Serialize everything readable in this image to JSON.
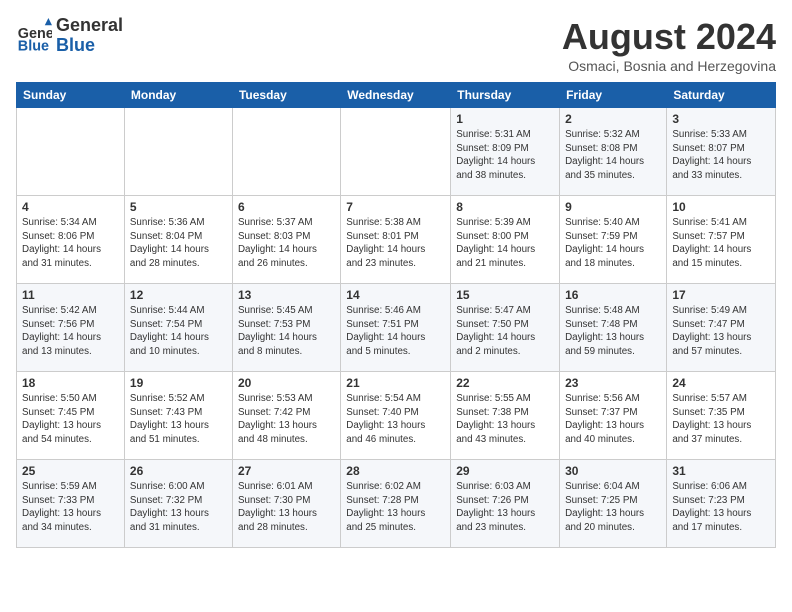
{
  "header": {
    "logo_line1": "General",
    "logo_line2": "Blue",
    "month_year": "August 2024",
    "location": "Osmaci, Bosnia and Herzegovina"
  },
  "weekdays": [
    "Sunday",
    "Monday",
    "Tuesday",
    "Wednesday",
    "Thursday",
    "Friday",
    "Saturday"
  ],
  "weeks": [
    [
      {
        "day": "",
        "info": ""
      },
      {
        "day": "",
        "info": ""
      },
      {
        "day": "",
        "info": ""
      },
      {
        "day": "",
        "info": ""
      },
      {
        "day": "1",
        "info": "Sunrise: 5:31 AM\nSunset: 8:09 PM\nDaylight: 14 hours\nand 38 minutes."
      },
      {
        "day": "2",
        "info": "Sunrise: 5:32 AM\nSunset: 8:08 PM\nDaylight: 14 hours\nand 35 minutes."
      },
      {
        "day": "3",
        "info": "Sunrise: 5:33 AM\nSunset: 8:07 PM\nDaylight: 14 hours\nand 33 minutes."
      }
    ],
    [
      {
        "day": "4",
        "info": "Sunrise: 5:34 AM\nSunset: 8:06 PM\nDaylight: 14 hours\nand 31 minutes."
      },
      {
        "day": "5",
        "info": "Sunrise: 5:36 AM\nSunset: 8:04 PM\nDaylight: 14 hours\nand 28 minutes."
      },
      {
        "day": "6",
        "info": "Sunrise: 5:37 AM\nSunset: 8:03 PM\nDaylight: 14 hours\nand 26 minutes."
      },
      {
        "day": "7",
        "info": "Sunrise: 5:38 AM\nSunset: 8:01 PM\nDaylight: 14 hours\nand 23 minutes."
      },
      {
        "day": "8",
        "info": "Sunrise: 5:39 AM\nSunset: 8:00 PM\nDaylight: 14 hours\nand 21 minutes."
      },
      {
        "day": "9",
        "info": "Sunrise: 5:40 AM\nSunset: 7:59 PM\nDaylight: 14 hours\nand 18 minutes."
      },
      {
        "day": "10",
        "info": "Sunrise: 5:41 AM\nSunset: 7:57 PM\nDaylight: 14 hours\nand 15 minutes."
      }
    ],
    [
      {
        "day": "11",
        "info": "Sunrise: 5:42 AM\nSunset: 7:56 PM\nDaylight: 14 hours\nand 13 minutes."
      },
      {
        "day": "12",
        "info": "Sunrise: 5:44 AM\nSunset: 7:54 PM\nDaylight: 14 hours\nand 10 minutes."
      },
      {
        "day": "13",
        "info": "Sunrise: 5:45 AM\nSunset: 7:53 PM\nDaylight: 14 hours\nand 8 minutes."
      },
      {
        "day": "14",
        "info": "Sunrise: 5:46 AM\nSunset: 7:51 PM\nDaylight: 14 hours\nand 5 minutes."
      },
      {
        "day": "15",
        "info": "Sunrise: 5:47 AM\nSunset: 7:50 PM\nDaylight: 14 hours\nand 2 minutes."
      },
      {
        "day": "16",
        "info": "Sunrise: 5:48 AM\nSunset: 7:48 PM\nDaylight: 13 hours\nand 59 minutes."
      },
      {
        "day": "17",
        "info": "Sunrise: 5:49 AM\nSunset: 7:47 PM\nDaylight: 13 hours\nand 57 minutes."
      }
    ],
    [
      {
        "day": "18",
        "info": "Sunrise: 5:50 AM\nSunset: 7:45 PM\nDaylight: 13 hours\nand 54 minutes."
      },
      {
        "day": "19",
        "info": "Sunrise: 5:52 AM\nSunset: 7:43 PM\nDaylight: 13 hours\nand 51 minutes."
      },
      {
        "day": "20",
        "info": "Sunrise: 5:53 AM\nSunset: 7:42 PM\nDaylight: 13 hours\nand 48 minutes."
      },
      {
        "day": "21",
        "info": "Sunrise: 5:54 AM\nSunset: 7:40 PM\nDaylight: 13 hours\nand 46 minutes."
      },
      {
        "day": "22",
        "info": "Sunrise: 5:55 AM\nSunset: 7:38 PM\nDaylight: 13 hours\nand 43 minutes."
      },
      {
        "day": "23",
        "info": "Sunrise: 5:56 AM\nSunset: 7:37 PM\nDaylight: 13 hours\nand 40 minutes."
      },
      {
        "day": "24",
        "info": "Sunrise: 5:57 AM\nSunset: 7:35 PM\nDaylight: 13 hours\nand 37 minutes."
      }
    ],
    [
      {
        "day": "25",
        "info": "Sunrise: 5:59 AM\nSunset: 7:33 PM\nDaylight: 13 hours\nand 34 minutes."
      },
      {
        "day": "26",
        "info": "Sunrise: 6:00 AM\nSunset: 7:32 PM\nDaylight: 13 hours\nand 31 minutes."
      },
      {
        "day": "27",
        "info": "Sunrise: 6:01 AM\nSunset: 7:30 PM\nDaylight: 13 hours\nand 28 minutes."
      },
      {
        "day": "28",
        "info": "Sunrise: 6:02 AM\nSunset: 7:28 PM\nDaylight: 13 hours\nand 25 minutes."
      },
      {
        "day": "29",
        "info": "Sunrise: 6:03 AM\nSunset: 7:26 PM\nDaylight: 13 hours\nand 23 minutes."
      },
      {
        "day": "30",
        "info": "Sunrise: 6:04 AM\nSunset: 7:25 PM\nDaylight: 13 hours\nand 20 minutes."
      },
      {
        "day": "31",
        "info": "Sunrise: 6:06 AM\nSunset: 7:23 PM\nDaylight: 13 hours\nand 17 minutes."
      }
    ]
  ]
}
